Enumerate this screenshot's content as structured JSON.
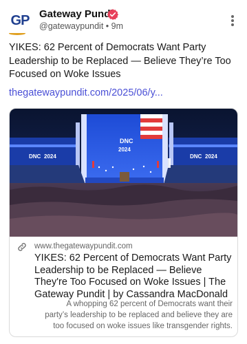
{
  "post": {
    "author_name": "Gateway Pundit",
    "handle": "@gatewaypundit",
    "separator": "•",
    "time": "9m",
    "avatar_letters": "GP",
    "text": "YIKES: 62 Percent of Democrats Want Party Leadership to be Replaced — Believe They’re Too Focused on Woke Issues",
    "link": "thegatewaypundit.com/2025/06/y..."
  },
  "card": {
    "domain": "www.thegatewaypundit.com",
    "title": "YIKES: 62 Percent of Democrats Want Party Leadership to be Replaced — Believe They're Too Focused on Woke Issues | The Gateway Pundit | by Cassandra MacDonald",
    "description": "A whopping 62 percent of Democrats want their party’s leadership to be replaced and believe they are too focused on woke issues like transgender rights.",
    "image_signage": [
      "DNC",
      "2024"
    ]
  },
  "icons": {
    "verified": "verified-badge-icon",
    "more": "more-vertical-icon",
    "link": "link-chain-icon"
  },
  "colors": {
    "link": "#4a4fd6",
    "verified": "#e8405a",
    "avatar": "#1f3f8f",
    "avatar_accent": "#e0a020"
  }
}
